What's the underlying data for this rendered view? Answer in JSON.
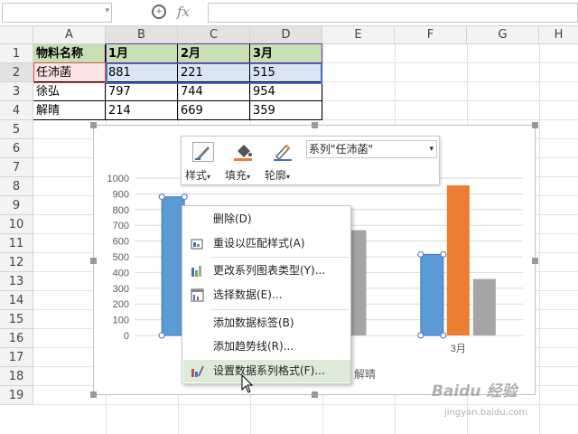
{
  "formula_bar": {
    "name_box": "",
    "formula": "",
    "fx_label": "fx",
    "zoom_icon": "zoom-icon"
  },
  "columns": [
    "A",
    "B",
    "C",
    "D",
    "E",
    "F",
    "G",
    "H"
  ],
  "rows": [
    "1",
    "2",
    "3",
    "4",
    "5",
    "6",
    "7",
    "8",
    "9",
    "10",
    "11",
    "12",
    "13",
    "14",
    "15",
    "16",
    "17",
    "18",
    "19"
  ],
  "table": {
    "header": [
      "物料名称",
      "1月",
      "2月",
      "3月"
    ],
    "rows": [
      [
        "任沛菡",
        "881",
        "221",
        "515"
      ],
      [
        "徐弘",
        "797",
        "744",
        "954"
      ],
      [
        "解晴",
        "214",
        "669",
        "359"
      ]
    ]
  },
  "chart_data": {
    "type": "bar",
    "categories": [
      "1月",
      "2月",
      "3月"
    ],
    "series": [
      {
        "name": "任沛菡",
        "values": [
          881,
          221,
          515
        ]
      },
      {
        "name": "徐弘",
        "values": [
          797,
          744,
          954
        ]
      },
      {
        "name": "解晴",
        "values": [
          214,
          669,
          359
        ]
      }
    ],
    "y_ticks": [
      "1000",
      "900",
      "800",
      "700",
      "600",
      "500",
      "400",
      "300",
      "200",
      "100",
      "0"
    ],
    "visible_category_label": "3月",
    "partial_legend_text": "解晴",
    "ylim": [
      0,
      1000
    ],
    "colors": [
      "#5b9bd5",
      "#ed7d31",
      "#a5a5a5"
    ],
    "grid": true
  },
  "toolbar": {
    "style_label": "样式",
    "fill_label": "填充",
    "outline_label": "轮廓",
    "series_select": "系列\"任沛菡\"",
    "dropdown_arrow": "▾",
    "icons": [
      "style-icon",
      "fill-bucket-icon",
      "outline-pen-icon"
    ]
  },
  "context_menu": {
    "items": [
      {
        "label": "删除(D)",
        "icon": ""
      },
      {
        "label": "重设以匹配样式(A)",
        "icon": "reset-style-icon"
      },
      {
        "label": "更改系列图表类型(Y)...",
        "icon": "change-chart-type-icon"
      },
      {
        "label": "选择数据(E)...",
        "icon": "select-data-icon"
      },
      {
        "label": "添加数据标签(B)",
        "icon": ""
      },
      {
        "label": "添加趋势线(R)...",
        "icon": ""
      },
      {
        "label": "设置数据系列格式(F)...",
        "icon": "format-series-icon"
      }
    ],
    "highlight_color": "#dcebd5"
  },
  "watermark": {
    "text": "Baidu 经验",
    "url": "jingyan.baidu.com"
  }
}
